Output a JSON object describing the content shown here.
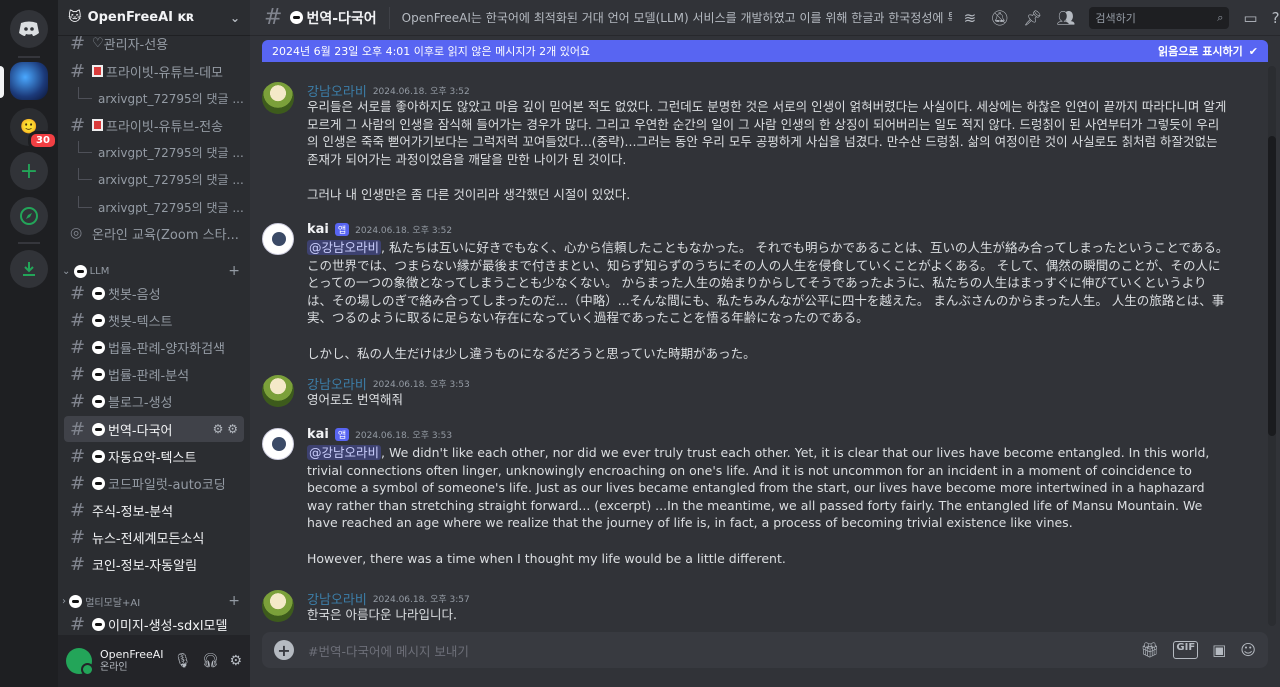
{
  "server": {
    "name": "OpenFreeAI ᴋʀ",
    "rail_badge": "30"
  },
  "channels": {
    "admin": "관리자-선용",
    "private_youtube_demo": "프라이빗-유튜브-데모",
    "thread_1": "arxivgpt_72795의 댓글 ...",
    "private_youtube_send": "프라이빗-유튜브-전송",
    "thread_2": "arxivgpt_72795의 댓글 ...",
    "thread_3": "arxivgpt_72795의 댓글 ...",
    "thread_4": "arxivgpt_72795의 댓글 ...",
    "online_edu": "온라인 교육(Zoom 스타...",
    "cat_llm": "LLM",
    "chatbot_voice": "챗봇-음성",
    "chatbot_text": "챗봇-텍스트",
    "law_quantum": "법률-판례-양자화검색",
    "law_analysis": "법률-판례-분석",
    "blog_gen": "블로그-생성",
    "translate": "번역-다국어",
    "auto_summary": "자동요약-텍스트",
    "copilot": "코드파일럿-auto코딩",
    "stock": "주식-정보-분석",
    "news": "뉴스-전세계모든소식",
    "coin": "코인-정보-자동알림",
    "cat_multimodal": "멀티모달+AI",
    "image_gen": "이미지-생성-sdxl모델"
  },
  "user": {
    "name": "OpenFreeAI",
    "status": "온라인"
  },
  "topbar": {
    "channel": "번역-다국어",
    "topic": "OpenFreeAI는 한국어에 최적화된 거대 언어 모델(LLM) 서비스를 개발하였고 이를 위해 한글과 한국정성에 특화...",
    "search_placeholder": "검색하기"
  },
  "banner": {
    "text": "2024년 6월 23일 오후 4:01 이후로 읽지 않은 메시지가 2개 있어요",
    "mark_read": "읽음으로 표시하기"
  },
  "messages": [
    {
      "author": "강남오라비",
      "time": "2024.06.18. 오후 3:52",
      "p1": "우리들은 서로를 좋아하지도 않았고 마음 깊이 믿어본 적도 없었다. 그런데도 분명한 것은 서로의 인생이 얽혀버렸다는 사실이다. 세상에는 하찮은 인연이 끝까지 따라다니며 알게 모르게 그 사람의 인생을 잠식해 들어가는 경우가 많다. 그리고 우연한 순간의 일이 그 사람 인생의 한 상징이 되어버리는 일도 적지 않다. 드렁칡이 된 사연부터가 그렇듯이 우리의 인생은 죽죽 뻗어가기보다는 그럭저럭 꼬여들었다...(중략)...그러는 동안 우리 모두 공평하게 사십을 넘겼다. 만수산 드렁칡. 삶의 여정이란 것이 사실로도 칡처럼 하잘것없는 존재가 되어가는 과정이었음을 깨달을 만한 나이가 된 것이다.",
      "p2": "그러나 내 인생만은 좀 다른 것이리라 생각했던 시절이 있었다."
    },
    {
      "author": "kai",
      "app_tag": "앱",
      "time": "2024.06.18. 오후 3:52",
      "mention": "@강남오라비",
      "p1": ", 私たちは互いに好きでもなく、心から信頼したこともなかった。 それでも明らかであることは、互いの人生が絡み合ってしまったということである。 この世界では、つまらない縁が最後まで付きまとい、知らず知らずのうちにその人の人生を侵食していくことがよくある。 そして、偶然の瞬間のことが、その人にとっての一つの象徴となってしまうことも少なくない。 からまった人生の始まりからしてそうであったように、私たちの人生はまっすぐに伸びていくというよりは、その場しのぎで絡み合ってしまったのだ...（中略）...そんな間にも、私たちみんなが公平に四十を越えた。 まんぶさんのからまった人生。 人生の旅路とは、事実、つるのように取るに足らない存在になっていく過程であったことを悟る年齢になったのである。",
      "p2": "しかし、私の人生だけは少し違うものになるだろうと思っていた時期があった。"
    },
    {
      "author": "강남오라비",
      "time": "2024.06.18. 오후 3:53",
      "p1": "영어로도 번역해줘"
    },
    {
      "author": "kai",
      "app_tag": "앱",
      "time": "2024.06.18. 오후 3:53",
      "mention": "@강남오라비",
      "p1": ", We didn't like each other, nor did we ever truly trust each other. Yet, it is clear that our lives have become entangled. In this world, trivial connections often linger, unknowingly encroaching on one's life. And it is not uncommon for an incident in a moment of coincidence to become a symbol of someone's life. Just as our lives became entangled from the start, our lives have become more intertwined in a haphazard way rather than stretching straight forward... (excerpt) ...In the meantime, we all passed forty fairly. The entangled life of Mansu Mountain. We have reached an age where we realize that the journey of life is, in fact, a process of becoming trivial existence like vines.",
      "p2": "However, there was a time when I thought my life would be a little different."
    },
    {
      "author": "강남오라비",
      "time": "2024.06.18. 오후 3:57",
      "p1": "한국은 아름다운 나라입니다."
    }
  ],
  "composer": {
    "placeholder": "#번역-다국어에 메시지 보내기",
    "gif": "GIF"
  },
  "colors": {
    "accent": "#5865f2",
    "author_kr": "#3c7ea8",
    "online": "#23a559",
    "badge": "#f23f43"
  }
}
